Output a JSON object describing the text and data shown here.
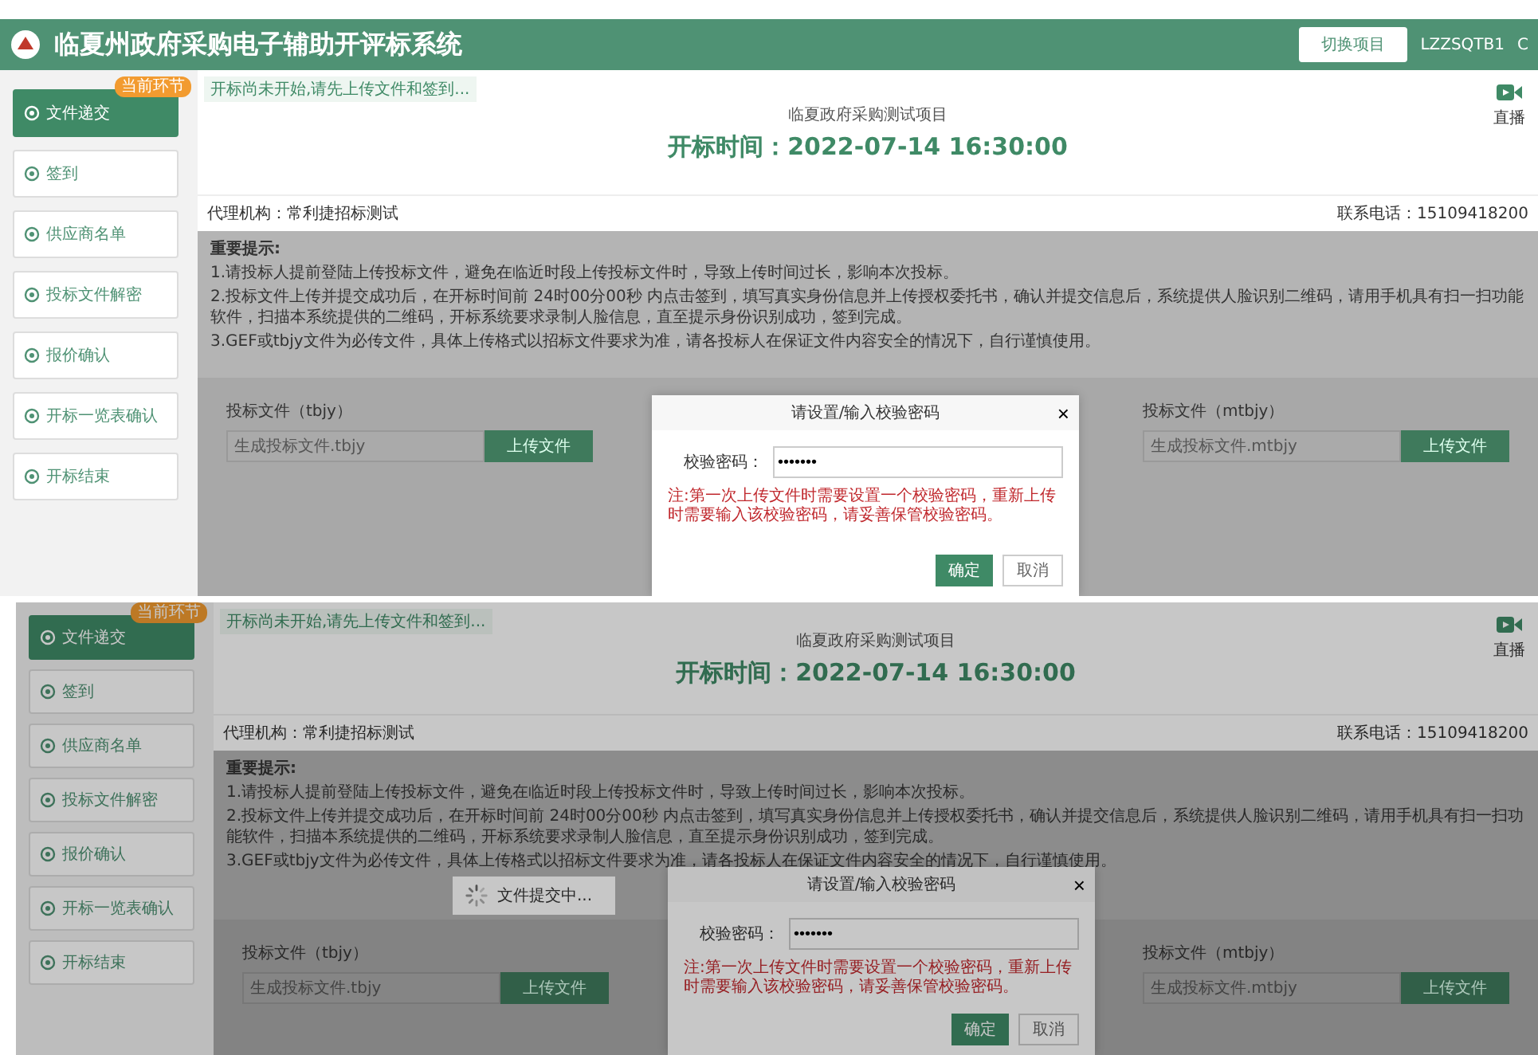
{
  "header": {
    "title": "临夏州政府采购电子辅助开评标系统",
    "switch_button": "切换项目",
    "user": "LZZSQTB1",
    "cut_text": "C"
  },
  "screens": [
    {
      "dimmed": false,
      "sidebar": [
        {
          "label": "文件递交",
          "selected": true,
          "badge": "当前环节"
        },
        {
          "label": "签到",
          "selected": false
        },
        {
          "label": "供应商名单",
          "selected": false
        },
        {
          "label": "投标文件解密",
          "selected": false
        },
        {
          "label": "报价确认",
          "selected": false
        },
        {
          "label": "开标一览表确认",
          "selected": false
        },
        {
          "label": "开标结束",
          "selected": false
        }
      ],
      "notice": "开标尚未开始,请先上传文件和签到...",
      "project": "临夏政府采购测试项目",
      "open_time": "开标时间：2022-07-14 16:30:00",
      "live": "直播",
      "agency": "代理机构：常利捷招标测试",
      "phone": "联系电话：15109418200",
      "tips_title": "重要提示:",
      "tips": [
        "1.请投标人提前登陆上传投标文件，避免在临近时段上传投标文件时，导致上传时间过长，影响本次投标。",
        "2.投标文件上传并提交成功后，在开标时间前 24时00分00秒 内点击签到，填写真实身份信息并上传授权委托书，确认并提交信息后，系统提供人脸识别二维码，请用手机具有扫一扫功能软件，扫描本系统提供的二维码，开标系统要求录制人脸信息，直至提示身份识别成功，签到完成。",
        "3.GEF或tbjy文件为必传文件，具体上传格式以招标文件要求为准，请各投标人在保证文件内容安全的情况下，自行谨慎使用。"
      ],
      "files": [
        {
          "label": "投标文件（tbjy）",
          "placeholder": "生成投标文件.tbjy",
          "button": "上传文件"
        },
        {
          "label": "投标文件（mtbjy）",
          "placeholder": "生成投标文件.mtbjy",
          "button": "上传文件"
        }
      ],
      "dialog": {
        "title": "请设置/输入校验密码",
        "close": "×",
        "field_label": "校验密码：",
        "value": "•••••••",
        "note": "注:第一次上传文件时需要设置一个校验密码，重新上传时需要输入该校验密码，请妥善保管校验密码。",
        "ok": "确定",
        "cancel": "取消"
      }
    },
    {
      "dimmed": true,
      "sidebar": [
        {
          "label": "文件递交",
          "selected": true,
          "badge": "当前环节"
        },
        {
          "label": "签到",
          "selected": false
        },
        {
          "label": "供应商名单",
          "selected": false
        },
        {
          "label": "投标文件解密",
          "selected": false
        },
        {
          "label": "报价确认",
          "selected": false
        },
        {
          "label": "开标一览表确认",
          "selected": false
        },
        {
          "label": "开标结束",
          "selected": false
        }
      ],
      "notice": "开标尚未开始,请先上传文件和签到...",
      "project": "临夏政府采购测试项目",
      "open_time": "开标时间：2022-07-14 16:30:00",
      "live": "直播",
      "agency": "代理机构：常利捷招标测试",
      "phone": "联系电话：15109418200",
      "tips_title": "重要提示:",
      "tips": [
        "1.请投标人提前登陆上传投标文件，避免在临近时段上传投标文件时，导致上传时间过长，影响本次投标。",
        "2.投标文件上传并提交成功后，在开标时间前 24时00分00秒 内点击签到，填写真实身份信息并上传授权委托书，确认并提交信息后，系统提供人脸识别二维码，请用手机具有扫一扫功能软件，扫描本系统提供的二维码，开标系统要求录制人脸信息，直至提示身份识别成功，签到完成。",
        "3.GEF或tbjy文件为必传文件，具体上传格式以招标文件要求为准，请各投标人在保证文件内容安全的情况下，自行谨慎使用。"
      ],
      "files": [
        {
          "label": "投标文件（tbjy）",
          "placeholder": "生成投标文件.tbjy",
          "button": "上传文件"
        },
        {
          "label": "投标文件（mtbjy）",
          "placeholder": "生成投标文件.mtbjy",
          "button": "上传文件"
        }
      ],
      "dialog": {
        "title": "请设置/输入校验密码",
        "close": "×",
        "field_label": "校验密码：",
        "value": "•••••••",
        "note": "注:第一次上传文件时需要设置一个校验密码，重新上传时需要输入该校验密码，请妥善保管校验密码。",
        "ok": "确定",
        "cancel": "取消"
      },
      "toast": "文件提交中..."
    }
  ]
}
